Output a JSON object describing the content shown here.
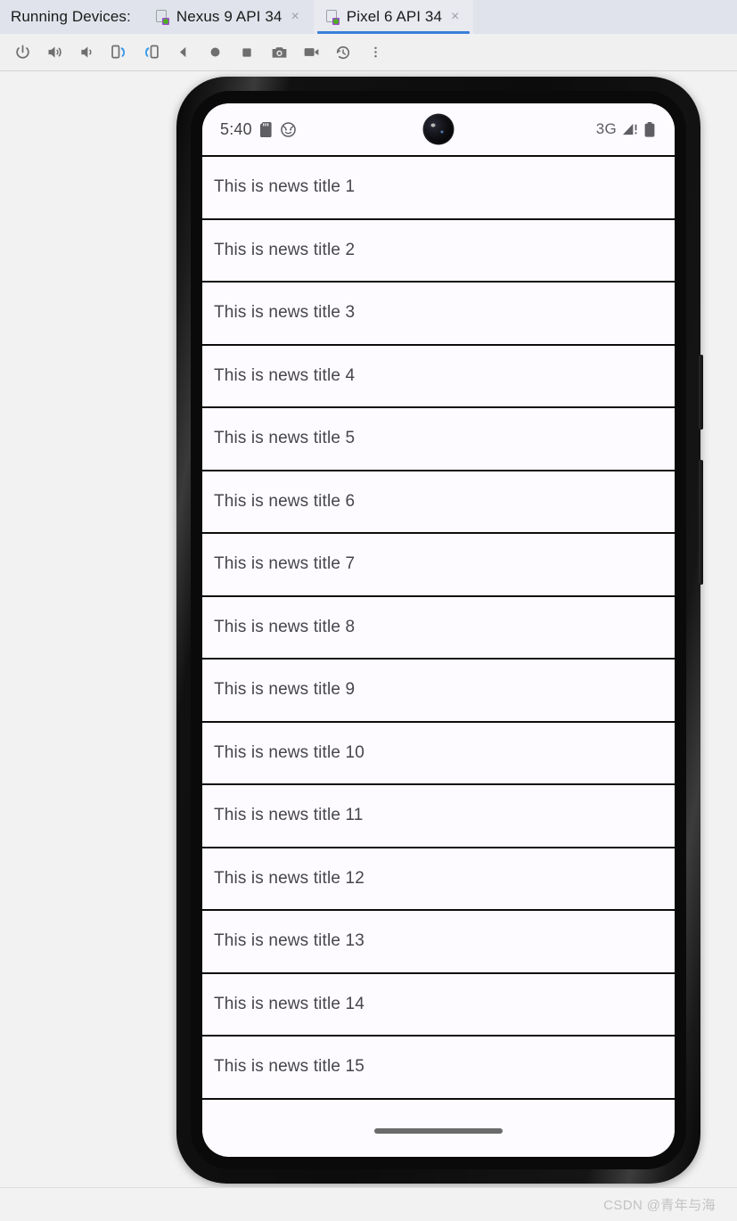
{
  "header": {
    "title": "Running Devices:",
    "tabs": [
      {
        "label": "Nexus 9 API 34",
        "close": "×",
        "selected": false
      },
      {
        "label": "Pixel 6 API 34",
        "close": "×",
        "selected": true
      }
    ]
  },
  "toolbar": {
    "buttons": [
      {
        "name": "power-button",
        "icon": "power-icon"
      },
      {
        "name": "volume-up-button",
        "icon": "volume-up-icon"
      },
      {
        "name": "volume-down-button",
        "icon": "volume-down-icon"
      },
      {
        "name": "rotate-left-button",
        "icon": "rotate-left-icon"
      },
      {
        "name": "rotate-right-button",
        "icon": "rotate-right-icon"
      },
      {
        "name": "back-button",
        "icon": "triangle-left-icon"
      },
      {
        "name": "home-button",
        "icon": "circle-icon"
      },
      {
        "name": "overview-button",
        "icon": "square-icon"
      },
      {
        "name": "screenshot-button",
        "icon": "camera-icon"
      },
      {
        "name": "record-button",
        "icon": "video-camera-icon"
      },
      {
        "name": "history-button",
        "icon": "clock-rewind-icon"
      },
      {
        "name": "more-button",
        "icon": "kebab-menu-icon"
      }
    ]
  },
  "device": {
    "status_bar": {
      "time": "5:40",
      "sd_card_icon": "sd-card-icon",
      "face_icon": "smiley-face-icon",
      "network": "3G",
      "signal_icon": "signal-warning-icon",
      "battery_icon": "battery-icon"
    },
    "news_items": [
      "This is news title 1",
      "This is news title 2",
      "This is news title 3",
      "This is news title 4",
      "This is news title 5",
      "This is news title 6",
      "This is news title 7",
      "This is news title 8",
      "This is news title 9",
      "This is news title 10",
      "This is news title 11",
      "This is news title 12",
      "This is news title 13",
      "This is news title 14",
      "This is news title 15"
    ]
  },
  "footer": {
    "watermark": "CSDN @青年与海"
  },
  "colors": {
    "header_bg": "#e0e3eb",
    "toolbar_bg": "#f0f0f0",
    "tab_accent": "#3b80d8",
    "page_bg": "#f2f2f2",
    "screen_bg": "#fdfbff",
    "divider": "#0d0d0d",
    "text": "#46464a"
  }
}
